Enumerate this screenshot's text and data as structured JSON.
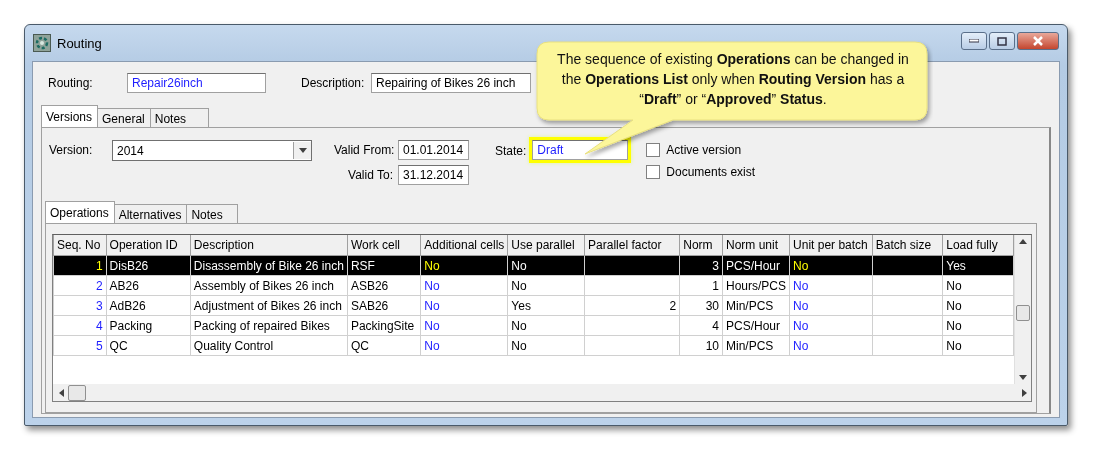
{
  "window": {
    "title": "Routing"
  },
  "header": {
    "routing_label": "Routing:",
    "routing": "Repair26inch",
    "description_label": "Description:",
    "description": "Repairing of Bikes 26 inch"
  },
  "tabs": [
    {
      "label": "Versions",
      "selected": true
    },
    {
      "label": "General",
      "selected": false
    },
    {
      "label": "Notes",
      "selected": false
    }
  ],
  "version": {
    "label": "Version:",
    "value": "2014",
    "valid_from_label": "Valid From:",
    "valid_from": "01.01.2014",
    "valid_to_label": "Valid To:",
    "valid_to": "31.12.2014",
    "state_label": "State:",
    "state": "Draft",
    "state_highlighted": true
  },
  "checkboxes": [
    {
      "label": "Active version",
      "checked": false
    },
    {
      "label": "Documents exist",
      "checked": false
    }
  ],
  "inner_tabs": [
    {
      "label": "Operations",
      "selected": true
    },
    {
      "label": "Alternatives",
      "selected": false
    },
    {
      "label": "Notes",
      "selected": false
    }
  ],
  "table": {
    "columns": [
      {
        "label": "Seq. No",
        "kind": "link_number"
      },
      {
        "label": "Operation ID",
        "kind": "text"
      },
      {
        "label": "Description",
        "kind": "text"
      },
      {
        "label": "Work cell",
        "kind": "text"
      },
      {
        "label": "Additional cells",
        "kind": "link"
      },
      {
        "label": "Use parallel",
        "kind": "text"
      },
      {
        "label": "Parallel factor",
        "kind": "number"
      },
      {
        "label": "Norm",
        "kind": "number"
      },
      {
        "label": "Norm unit",
        "kind": "text"
      },
      {
        "label": "Unit per batch",
        "kind": "link"
      },
      {
        "label": "Batch size",
        "kind": "text"
      },
      {
        "label": "Load fully",
        "kind": "text"
      }
    ],
    "rows": [
      {
        "selected": true,
        "cells": [
          "1",
          "DisB26",
          "Disassembly of Bike 26 inch",
          "RSF",
          "No",
          "No",
          null,
          "3",
          "PCS/Hour",
          "No",
          null,
          "Yes"
        ]
      },
      {
        "selected": false,
        "cells": [
          "2",
          "AB26",
          "Assembly of Bikes 26 inch",
          "ASB26",
          "No",
          "No",
          null,
          "1",
          "Hours/PCS",
          "No",
          null,
          "No"
        ]
      },
      {
        "selected": false,
        "cells": [
          "3",
          "AdB26",
          "Adjustment of Bikes 26 inch",
          "SAB26",
          "No",
          "Yes",
          "2",
          "30",
          "Min/PCS",
          "No",
          null,
          "No"
        ]
      },
      {
        "selected": false,
        "cells": [
          "4",
          "Packing",
          "Packing of repaired Bikes",
          "PackingSite",
          "No",
          "No",
          null,
          "4",
          "PCS/Hour",
          "No",
          null,
          "No"
        ]
      },
      {
        "selected": false,
        "cells": [
          "5",
          "QC",
          "Quality Control",
          "QC",
          "No",
          "No",
          null,
          "10",
          "Min/PCS",
          "No",
          null,
          "No"
        ]
      }
    ]
  },
  "callout": {
    "text": "The sequence of existing **Operations** can be changed in the **Operations List** only when **Routing Version** has a “**Draft**” or “**Approved**” **Status**."
  }
}
